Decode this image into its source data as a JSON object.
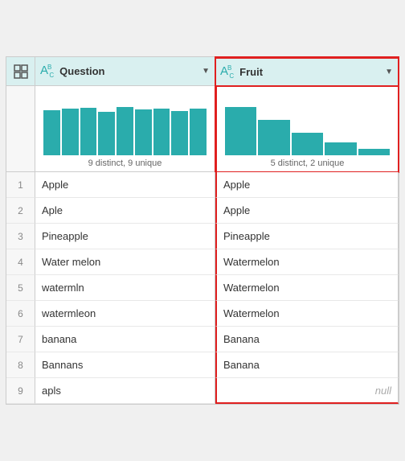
{
  "header": {
    "grid_icon": "⊞",
    "col1": {
      "icon": "AB",
      "label": "Question",
      "subscript": "C"
    },
    "col2": {
      "icon": "AB",
      "label": "Fruit",
      "subscript": "C"
    }
  },
  "chart": {
    "col1": {
      "label": "9 distinct, 9 unique",
      "bars": [
        70,
        72,
        74,
        68,
        75,
        71,
        73,
        69,
        72
      ]
    },
    "col2": {
      "label": "5 distinct, 2 unique",
      "bars": [
        75,
        55,
        35,
        20,
        10
      ]
    }
  },
  "rows": [
    {
      "num": "1",
      "question": "Apple",
      "fruit": "Apple"
    },
    {
      "num": "2",
      "question": "Aple",
      "fruit": "Apple"
    },
    {
      "num": "3",
      "question": "Pineapple",
      "fruit": "Pineapple"
    },
    {
      "num": "4",
      "question": "Water melon",
      "fruit": "Watermelon"
    },
    {
      "num": "5",
      "question": "watermln",
      "fruit": "Watermelon"
    },
    {
      "num": "6",
      "question": "watermleon",
      "fruit": "Watermelon"
    },
    {
      "num": "7",
      "question": "banana",
      "fruit": "Banana"
    },
    {
      "num": "8",
      "question": "Bannans",
      "fruit": "Banana"
    },
    {
      "num": "9",
      "question": "apls",
      "fruit": "null"
    }
  ],
  "labels": {
    "null": "null"
  }
}
